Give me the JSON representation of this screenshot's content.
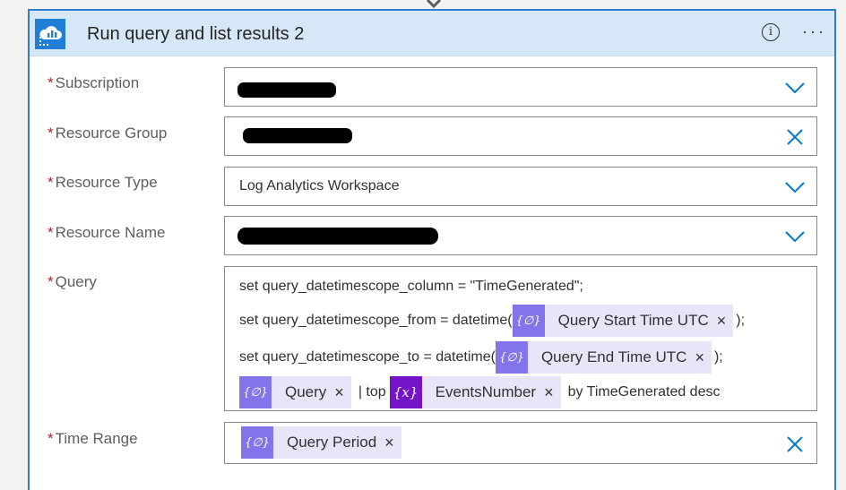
{
  "card": {
    "title": "Run query and list results 2",
    "info_glyph": "i",
    "more_glyph": "···",
    "logo_icon": "azure-monitor-logs-icon"
  },
  "required_mark": "*",
  "fields": {
    "subscription": {
      "label": "Subscription",
      "control": "dropdown",
      "value_redacted": true
    },
    "resource_group": {
      "label": "Resource Group",
      "control": "clearable",
      "value_redacted": true
    },
    "resource_type": {
      "label": "Resource Type",
      "control": "dropdown",
      "value": "Log Analytics Workspace"
    },
    "resource_name": {
      "label": "Resource Name",
      "control": "dropdown",
      "value_redacted": true
    },
    "query": {
      "label": "Query",
      "line1": "set query_datetimescope_column = \"TimeGenerated\";",
      "line2_prefix": "set query_datetimescope_from = datetime(",
      "line2_token": "Query Start Time UTC",
      "line2_suffix": ");",
      "line3_prefix": "set query_datetimescope_to = datetime(",
      "line3_token": "Query End Time UTC",
      "line3_suffix": ");",
      "line4_token1": "Query",
      "line4_mid": "| top",
      "line4_token2": "EventsNumber",
      "line4_suffix": "by TimeGenerated desc"
    },
    "time_range": {
      "label": "Time Range",
      "token": "Query Period",
      "control": "clearable"
    }
  },
  "token_close_glyph": "×",
  "token_icons": {
    "expression": "{∅}",
    "variable": "{x}"
  },
  "colors": {
    "header_bg": "#d6e8f7",
    "card_border": "#2e7bcf",
    "accent": "#0078d4",
    "required": "#a4262c",
    "expression_token": "#8274ea",
    "variable_token": "#7413c7",
    "token_bg": "#e9e5f9"
  }
}
